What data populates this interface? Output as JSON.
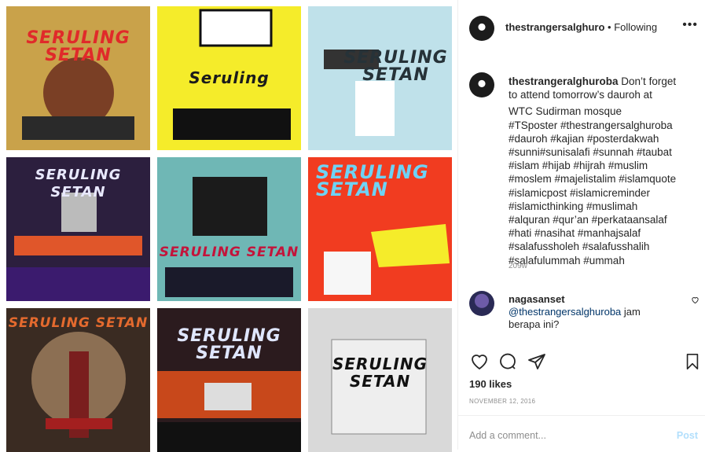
{
  "header": {
    "username": "thestrangersalghuro",
    "follow_label": "• Following",
    "more_label": "•••"
  },
  "grid": {
    "tiles": [
      {
        "title": "SERULING\nSETAN",
        "bg": "#c9a24a",
        "fg": "#e02a2a"
      },
      {
        "title": "Seruling",
        "bg": "#f5ec2a",
        "fg": "#1b1b1b"
      },
      {
        "title": "SERULING\nSETAN",
        "bg": "#bfe1ea",
        "fg": "#263238"
      },
      {
        "title": "SERULING\nSETAN",
        "bg": "#2c1f3e",
        "fg": "#e9e9ff"
      },
      {
        "title": "SERULING SETAN",
        "bg": "#6fb7b5",
        "fg": "#c3143b"
      },
      {
        "title": "SERULING\nSETAN",
        "bg": "#f13c20",
        "fg": "#6ed3f5"
      },
      {
        "title": "SERULING SETAN",
        "bg": "#3a2b22",
        "fg": "#e46a2e"
      },
      {
        "title": "SERULING\nSETAN",
        "bg": "#2b1b1e",
        "fg": "#dfe6ff"
      },
      {
        "title": "SERULING\nSETAN",
        "bg": "#d9d9d9",
        "fg": "#111111"
      }
    ]
  },
  "caption": {
    "username": "thestrangeralghuroba",
    "lines": [
      "Don’t forget",
      "to attend tomorrow’s dauroh at",
      "",
      "WTC Sudirman mosque",
      "#TSposter #thestrangersalghuroba",
      "#dauroh #kajian #posterdakwah",
      "#sunni#sunisalafi #sunnah #taubat",
      "#islam #hijab #hijrah #muslim",
      "#moslem #majelistalim #islamquote",
      "#islamicpost #islamicreminder",
      "#islamicthinking #muslimah",
      "#alquran #qur’an #perkataansalaf",
      "#hati #nasihat #manhajsalaf",
      "#salafussholeh #salafusshalih",
      "#salafulummah #ummah"
    ],
    "age": "209w"
  },
  "comment": {
    "username": "nagasanset",
    "mention": "@thestrangersalghuroba",
    "text": " jam berapa ini?"
  },
  "actions": {
    "likes": "190 likes",
    "date": "NOVEMBER 12, 2016"
  },
  "composer": {
    "placeholder": "Add a comment...",
    "post_label": "Post"
  }
}
